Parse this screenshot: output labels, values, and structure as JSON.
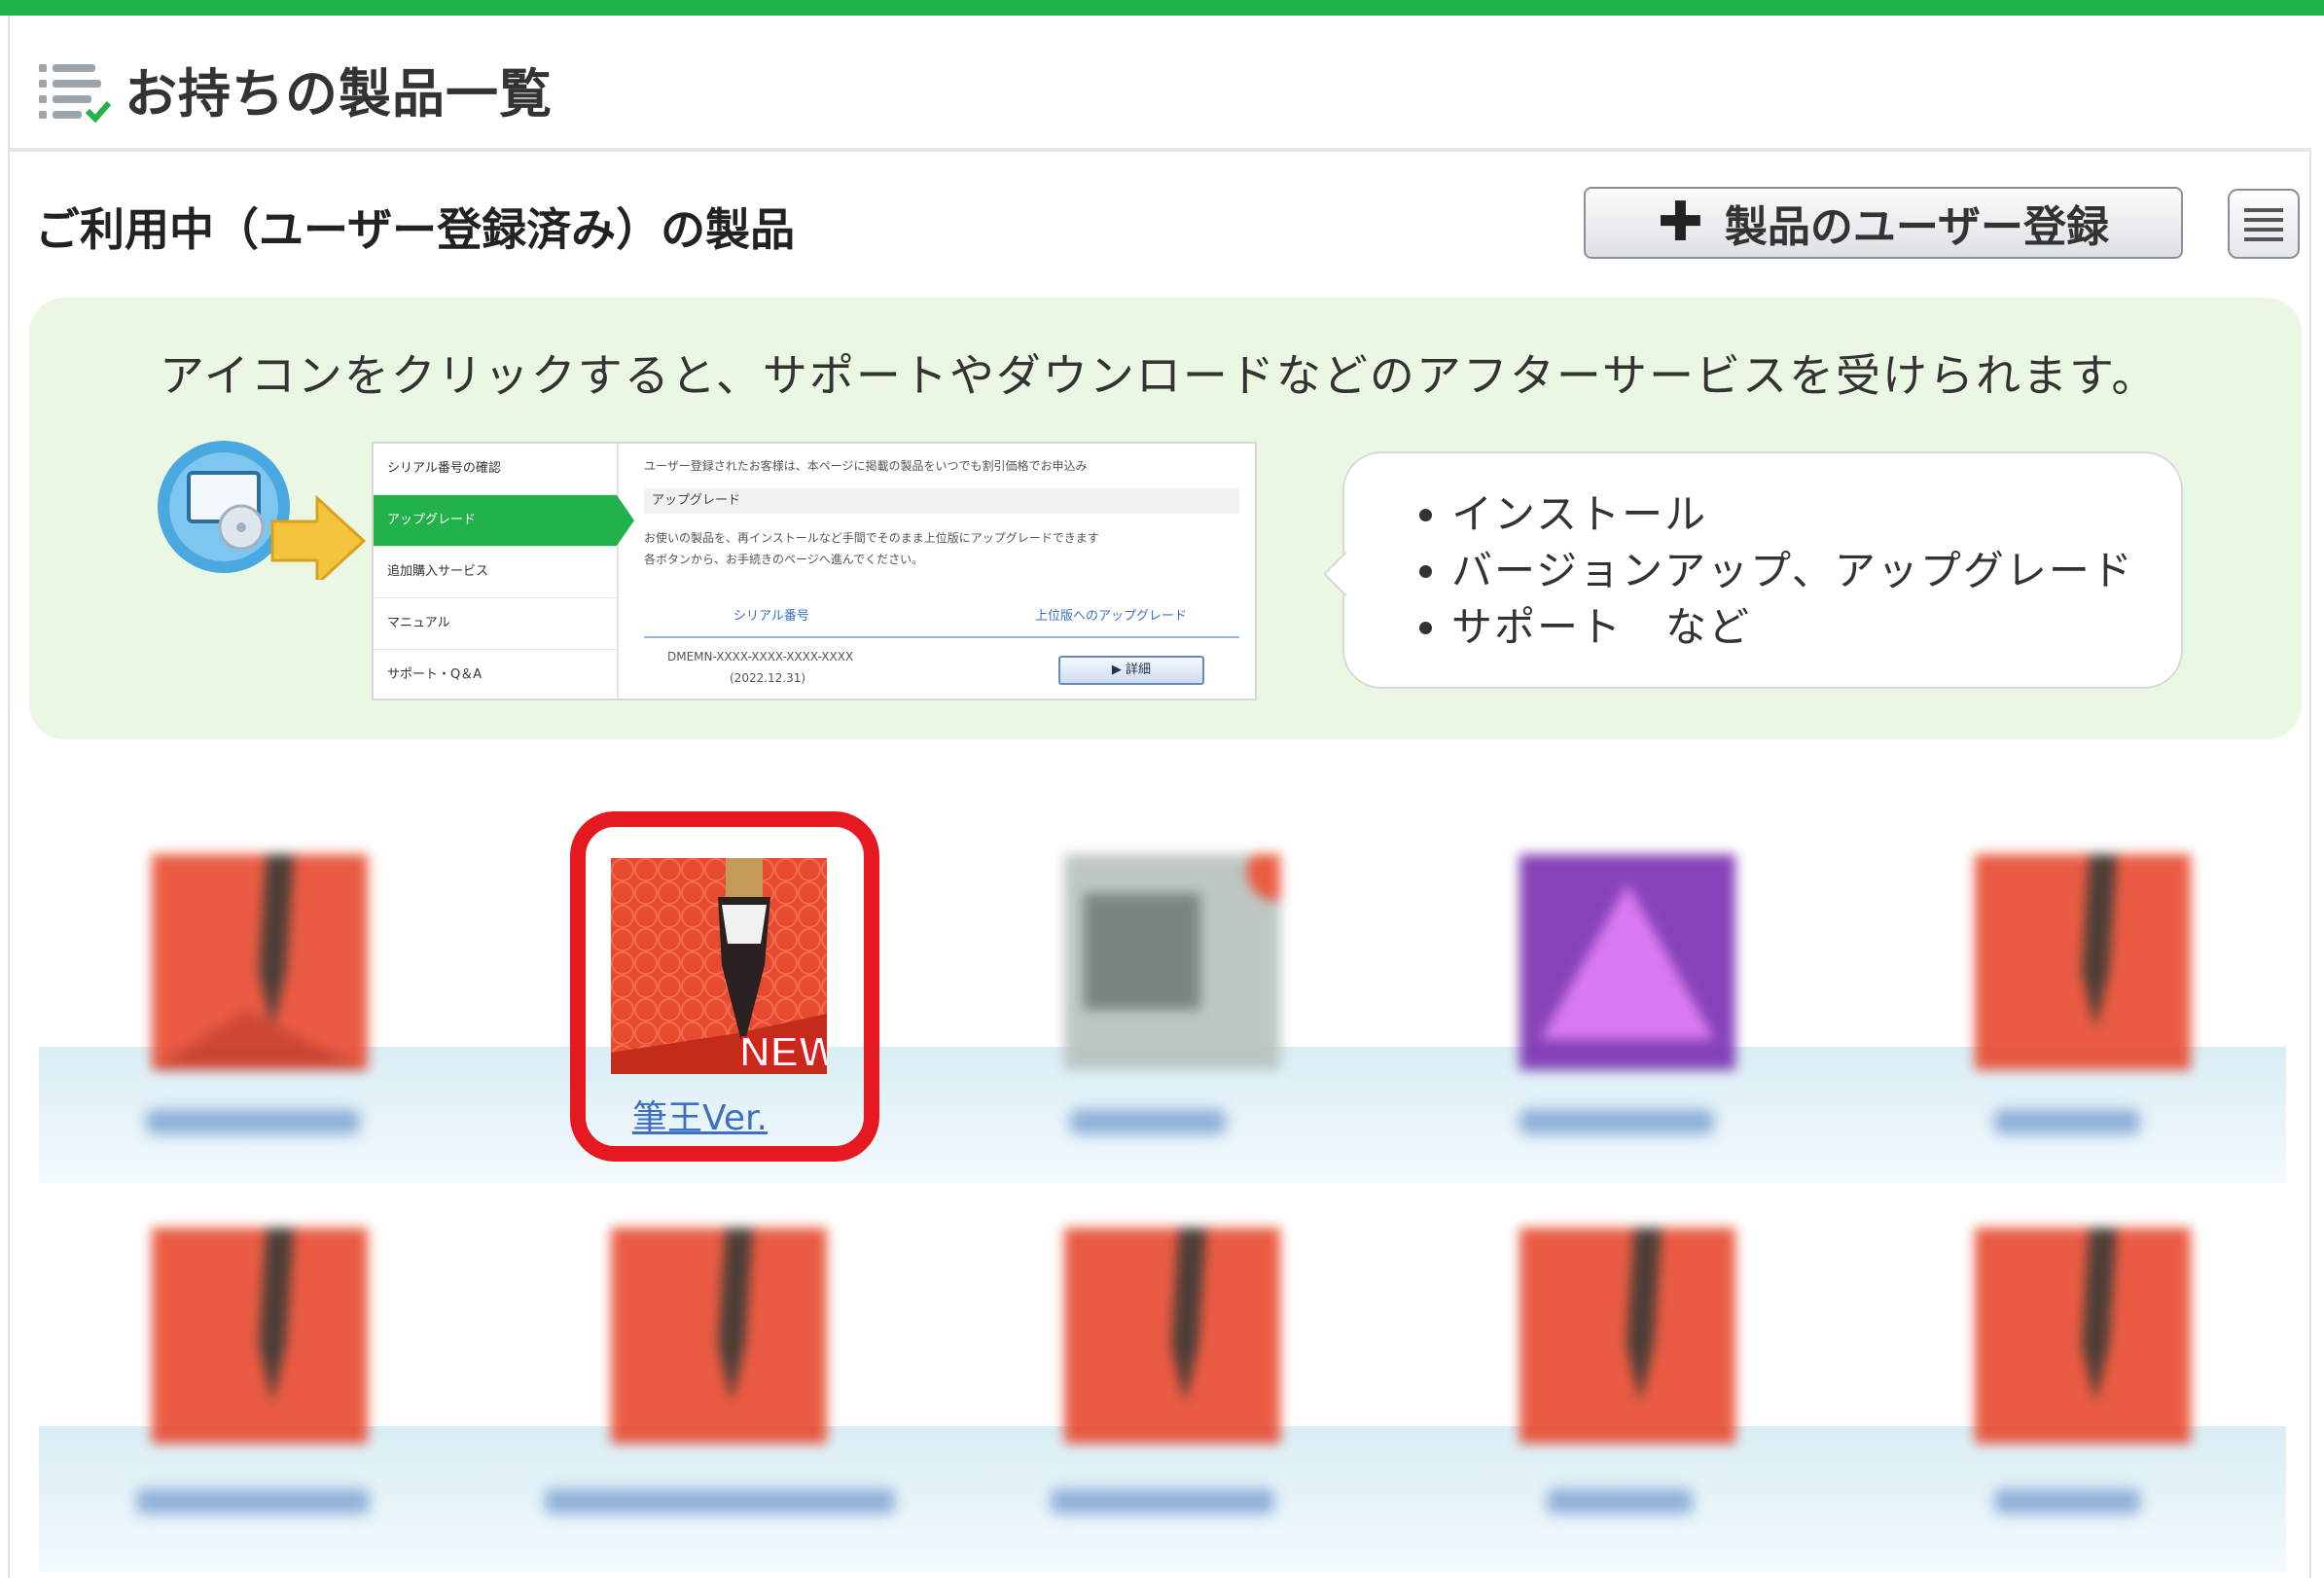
{
  "header": {
    "title": "お持ちの製品一覧",
    "icon": "list-check-icon"
  },
  "section": {
    "title": "ご利用中（ユーザー登録済み）の製品",
    "register_button_label": "製品のユーザー登録",
    "register_button_icon": "plus-icon",
    "menu_button_icon": "menu-lines-icon"
  },
  "info": {
    "text": "アイコンをクリックすると、サポートやダウンロードなどのアフターサービスを受けられます。",
    "screenshot": {
      "sidebar": [
        "シリアル番号の確認",
        "アップグレード",
        "追加購入サービス",
        "マニュアル",
        "サポート・Q＆A"
      ],
      "intro": "ユーザー登録されたお客様は、本ページに掲載の製品をいつでも割引価格でお申込み",
      "heading": "アップグレード",
      "desc_line1": "お使いの製品を、再インストールなど手間でそのまま上位版にアップグレードできます",
      "desc_line2": "各ボタンから、お手続きのページへ進んでください。",
      "col_serial": "シリアル番号",
      "col_upgrade": "上位版へのアップグレード",
      "serial": "DMEMN-XXXX-XXXX-XXXX-XXXX",
      "date": "(2022.12.31)",
      "detail_button": "▶ 詳細"
    },
    "bullets": [
      "インストール",
      "バージョンアップ、アップグレード",
      "サポート　など"
    ]
  },
  "products": {
    "featured_label": "筆王Ver.",
    "featured_badge": "NEW",
    "colors": {
      "accent_green": "#22b24c",
      "product_red": "#e84a2f",
      "highlight_red": "#e5191f",
      "link_blue": "#3f6fc0"
    }
  }
}
